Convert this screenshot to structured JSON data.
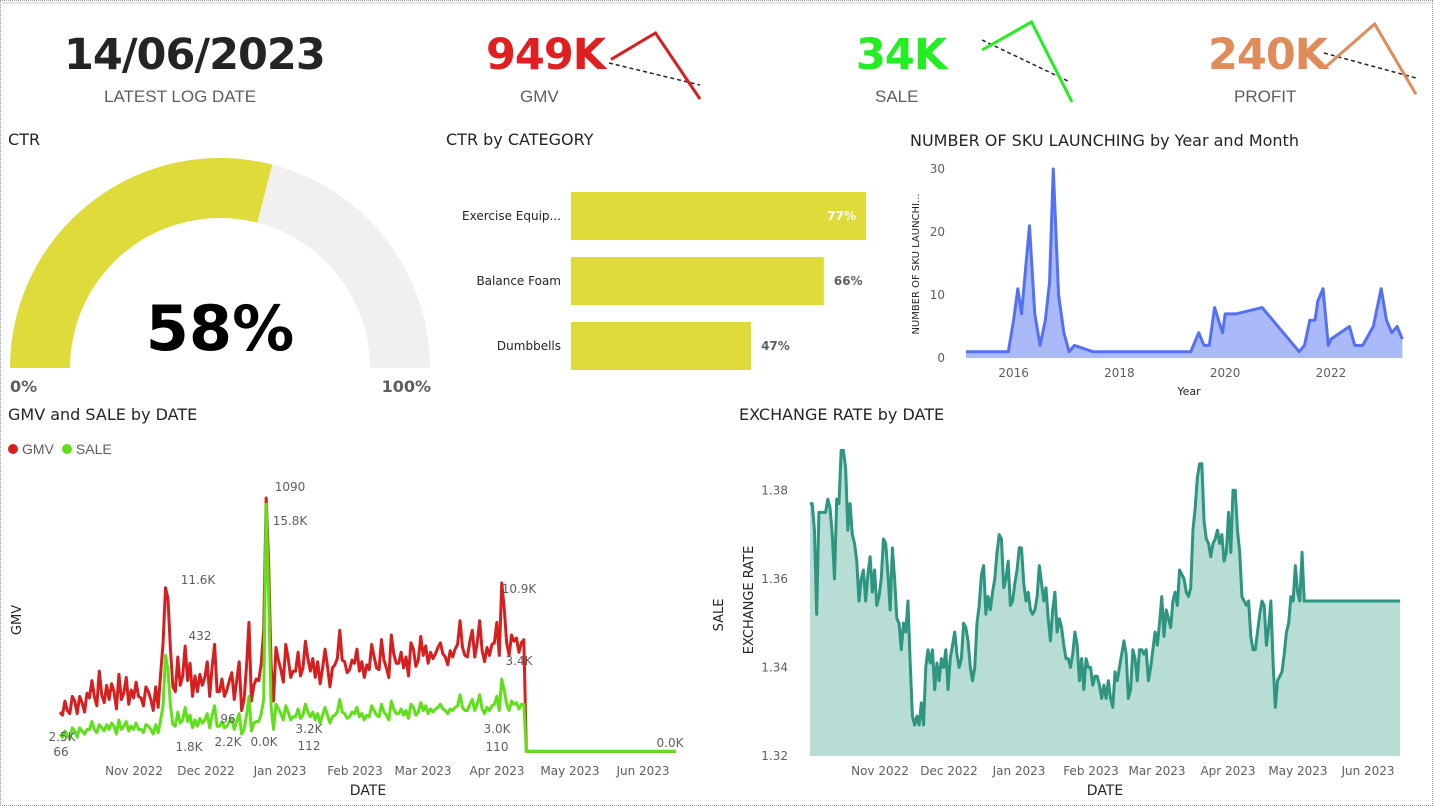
{
  "kpis": {
    "date": {
      "value": "14/06/2023",
      "label": "LATEST LOG DATE"
    },
    "gmv": {
      "value": "949K",
      "label": "GMV",
      "color": "#e02020"
    },
    "sale": {
      "value": "34K",
      "label": "SALE",
      "color": "#22ee22"
    },
    "profit": {
      "value": "240K",
      "label": "PROFIT",
      "color": "#e08c5a"
    }
  },
  "colors": {
    "gauge": "#dedb3a",
    "gauge_bg": "#f1f0ef",
    "bar": "#dedb3a",
    "sku_line": "#5470f5",
    "sku_fill": "#aabaf8",
    "gmv": "#d71f1f",
    "sale": "#5fe01a",
    "fx_line": "#2e9580",
    "fx_fill": "#b7ddd5"
  },
  "chart_data": [
    {
      "type": "gauge",
      "title": "CTR",
      "value": 58,
      "value_label": "58%",
      "min_label": "0%",
      "max_label": "100%"
    },
    {
      "type": "bar",
      "title": "CTR by CATEGORY",
      "categories": [
        "Exercise Equip...",
        "Balance Foam",
        "Dumbbells"
      ],
      "values": [
        77,
        66,
        47
      ],
      "value_labels": [
        "77%",
        "66%",
        "47%"
      ]
    },
    {
      "type": "area",
      "title": "NUMBER OF SKU LAUNCHING by Year and Month",
      "xlabel": "Year",
      "ylabel": "NUMBER OF SKU LAUNCHI...",
      "xticks": [
        "2016",
        "2018",
        "2020",
        "2022"
      ],
      "yticks": [
        "0",
        "10",
        "20",
        "30"
      ],
      "xlim": [
        2015.1,
        2023.4
      ],
      "ylim": [
        0,
        30
      ],
      "x": [
        2015.1,
        2015.4,
        2015.7,
        2015.9,
        2016.0,
        2016.08,
        2016.15,
        2016.3,
        2016.4,
        2016.5,
        2016.55,
        2016.6,
        2016.68,
        2016.75,
        2016.85,
        2016.95,
        2017.05,
        2017.15,
        2017.5,
        2018.5,
        2019.35,
        2019.5,
        2019.6,
        2019.7,
        2019.8,
        2019.95,
        2020.0,
        2020.2,
        2020.7,
        2021.4,
        2021.5,
        2021.6,
        2021.7,
        2021.75,
        2021.85,
        2021.95,
        2022.0,
        2022.35,
        2022.45,
        2022.6,
        2022.8,
        2022.95,
        2023.05,
        2023.15,
        2023.25,
        2023.35
      ],
      "values": [
        1,
        1,
        1,
        1,
        6,
        11,
        7,
        21,
        7,
        2,
        4,
        6,
        12,
        30,
        10,
        4,
        1,
        2,
        1,
        1,
        1,
        4,
        2,
        2,
        8,
        4,
        7,
        7,
        8,
        1,
        2,
        6,
        6,
        9,
        11,
        2,
        3,
        5,
        2,
        2,
        5,
        11,
        6,
        4,
        5,
        3
      ]
    },
    {
      "type": "line",
      "title": "GMV and SALE by DATE",
      "xlabel": "DATE",
      "ylabel": "GMV",
      "xticks": [
        "Nov 2022",
        "Dec 2022",
        "Jan 2023",
        "Feb 2023",
        "Mar 2023",
        "Apr 2023",
        "May 2023",
        "Jun 2023"
      ],
      "series": [
        {
          "name": "GMV",
          "data_labels": [
            "2.5K",
            "11.6K",
            "1.8K",
            "2.2K",
            "0.0K",
            "1090",
            "3.2K",
            "10.9K",
            "3.0K",
            "0.0K"
          ],
          "values": [
            2.6,
            2.4,
            3.3,
            2.7,
            2.5,
            3.6,
            3.3,
            2.5,
            3.6,
            3.2,
            2.6,
            3.8,
            3.5,
            4.6,
            3.6,
            3.0,
            5.2,
            3.7,
            3.2,
            4.3,
            3.4,
            4.4,
            3.9,
            2.8,
            5.0,
            3.4,
            3.8,
            4.8,
            3.1,
            4.0,
            3.5,
            4.5,
            3.6,
            3.5,
            3.0,
            4.2,
            3.9,
            3.4,
            2.7,
            4.2,
            2.9,
            5.0,
            7.0,
            10.5,
            9.8,
            6.6,
            4.2,
            3.9,
            6.1,
            4.3,
            4.9,
            6.8,
            4.6,
            5.7,
            3.6,
            4.9,
            3.9,
            5.0,
            4.3,
            4.8,
            5.8,
            3.6,
            5.5,
            6.9,
            3.9,
            3.9,
            4.7,
            3.6,
            4.0,
            4.6,
            5.1,
            3.4,
            4.6,
            5.8,
            2.7,
            3.4,
            5.5,
            8.3,
            3.3,
            4.3,
            4.7,
            4.6,
            5.7,
            7.8,
            16.2,
            12.2,
            5.6,
            3.3,
            6.7,
            5.9,
            5.3,
            4.5,
            6.9,
            6.0,
            4.8,
            5.2,
            5.2,
            6.4,
            4.9,
            5.4,
            7.1,
            6.0,
            5.2,
            6.0,
            4.8,
            5.8,
            4.4,
            5.4,
            6.6,
            5.5,
            4.2,
            5.4,
            5.6,
            6.0,
            7.8,
            5.9,
            5.8,
            5.1,
            5.3,
            5.9,
            5.7,
            6.6,
            5.2,
            5.8,
            4.8,
            5.6,
            5.3,
            6.9,
            6.1,
            5.4,
            5.3,
            7.2,
            5.9,
            5.4,
            4.8,
            7.5,
            6.3,
            5.7,
            5.7,
            6.4,
            5.4,
            6.1,
            4.9,
            7.0,
            6.6,
            5.5,
            5.9,
            7.4,
            6.2,
            6.8,
            5.7,
            6.4,
            6.0,
            6.3,
            6.7,
            7.0,
            6.3,
            6.1,
            5.6,
            6.5,
            6.1,
            6.6,
            6.9,
            8.4,
            6.7,
            6.2,
            6.1,
            7.1,
            7.8,
            6.1,
            7.0,
            8.4,
            6.5,
            5.8,
            6.7,
            6.2,
            6.9,
            7.0,
            8.3,
            6.2,
            10.8,
            9.2,
            7.0,
            6.2,
            7.5,
            7.1,
            7.3,
            6.4,
            7.0,
            7.2,
            0.2,
            0.1,
            0.1,
            0.1,
            0.1,
            0.1,
            0.1,
            0.1,
            0.1,
            0.1,
            0.1,
            0.1,
            0.1,
            0.1,
            0.1,
            0.1,
            0.1,
            0.1,
            0.1,
            0.1,
            0.1,
            0.1,
            0.1,
            0.1,
            0.1,
            0.1,
            0.1,
            0.1,
            0.1,
            0.1,
            0.1,
            0.1,
            0.1,
            0.1,
            0.1,
            0.1,
            0.1,
            0.1,
            0.1,
            0.1,
            0.1,
            0.1,
            0.1,
            0.1,
            0.1,
            0.1,
            0.1,
            0.1,
            0.1,
            0.1,
            0.1,
            0.1,
            0.1,
            0.1,
            0.1,
            0.1,
            0.1,
            0.1,
            0.1,
            0.1,
            0.1,
            0.1
          ]
        },
        {
          "name": "SALE",
          "data_labels": [
            "66",
            "432",
            "96",
            "15.8K",
            "112",
            "110",
            "3.4K"
          ],
          "values": [
            1.2,
            1.0,
            1.4,
            1.1,
            0.9,
            1.6,
            1.4,
            1.0,
            1.6,
            1.4,
            1.2,
            1.5,
            1.5,
            2.0,
            1.5,
            1.3,
            1.8,
            1.6,
            1.4,
            1.8,
            1.5,
            1.9,
            1.7,
            1.2,
            2.1,
            1.5,
            1.7,
            2.0,
            1.4,
            1.7,
            1.5,
            1.9,
            1.5,
            1.5,
            1.3,
            1.8,
            1.7,
            1.5,
            1.2,
            1.8,
            1.3,
            2.1,
            3.0,
            6.2,
            5.3,
            3.0,
            1.8,
            1.7,
            2.6,
            1.9,
            2.1,
            2.9,
            2.0,
            2.4,
            1.6,
            2.1,
            1.7,
            2.2,
            1.9,
            2.1,
            2.5,
            1.6,
            2.4,
            3.0,
            1.7,
            1.7,
            2.0,
            1.6,
            1.7,
            2.0,
            2.2,
            1.5,
            2.0,
            2.5,
            1.2,
            1.5,
            2.4,
            3.6,
            1.4,
            1.9,
            2.0,
            2.0,
            2.5,
            3.4,
            15.8,
            10.2,
            3.0,
            1.5,
            3.1,
            2.8,
            2.5,
            2.1,
            3.0,
            2.6,
            2.1,
            2.3,
            2.3,
            2.8,
            2.2,
            2.4,
            3.1,
            2.6,
            2.3,
            2.6,
            2.1,
            2.5,
            1.9,
            2.4,
            2.9,
            2.4,
            1.9,
            2.3,
            2.4,
            2.6,
            3.4,
            2.6,
            2.5,
            2.2,
            2.3,
            2.6,
            2.5,
            2.9,
            2.3,
            2.5,
            2.1,
            2.4,
            2.3,
            3.0,
            2.7,
            2.4,
            2.3,
            3.1,
            2.6,
            2.4,
            2.1,
            3.3,
            2.8,
            2.5,
            2.5,
            2.8,
            2.4,
            2.7,
            2.2,
            3.1,
            2.9,
            2.4,
            2.6,
            3.2,
            2.7,
            3.0,
            2.5,
            2.8,
            2.6,
            2.8,
            2.9,
            3.1,
            2.8,
            2.7,
            2.5,
            2.8,
            2.7,
            2.9,
            3.0,
            3.7,
            2.9,
            2.7,
            2.7,
            3.1,
            3.4,
            2.7,
            3.1,
            3.7,
            2.8,
            2.5,
            2.9,
            2.7,
            3.0,
            3.1,
            3.6,
            2.7,
            4.7,
            4.0,
            3.1,
            2.7,
            3.3,
            3.1,
            3.2,
            2.8,
            3.1,
            3.1,
            0.1,
            0.1,
            0.1,
            0.1,
            0.1,
            0.1,
            0.1,
            0.1,
            0.1,
            0.1,
            0.1,
            0.1,
            0.1,
            0.1,
            0.1,
            0.1,
            0.1,
            0.1,
            0.1,
            0.1,
            0.1,
            0.1,
            0.1,
            0.1,
            0.1,
            0.1,
            0.1,
            0.1,
            0.1,
            0.1,
            0.1,
            0.1,
            0.1,
            0.1,
            0.1,
            0.1,
            0.1,
            0.1,
            0.1,
            0.1,
            0.1,
            0.1,
            0.1,
            0.1,
            0.1,
            0.1,
            0.1,
            0.1,
            0.1,
            0.1,
            0.1,
            0.1,
            0.1,
            0.1,
            0.1,
            0.1,
            0.1,
            0.1,
            0.1,
            0.1,
            0.1,
            0.1
          ]
        }
      ]
    },
    {
      "type": "area",
      "title": "EXCHANGE RATE by DATE",
      "xlabel": "DATE",
      "ylabel": "EXCHANGE RATE",
      "ylabel2": "SALE",
      "xticks": [
        "Nov 2022",
        "Dec 2022",
        "Jan 2023",
        "Feb 2023",
        "Mar 2023",
        "Apr 2023",
        "May 2023",
        "Jun 2023"
      ],
      "yticks": [
        "1.32",
        "1.34",
        "1.36",
        "1.38"
      ],
      "ylim": [
        1.32,
        1.39
      ],
      "values": [
        1.377,
        1.377,
        1.371,
        1.352,
        1.375,
        1.375,
        1.375,
        1.375,
        1.378,
        1.376,
        1.37,
        1.36,
        1.378,
        1.377,
        1.389,
        1.389,
        1.385,
        1.371,
        1.377,
        1.37,
        1.368,
        1.364,
        1.355,
        1.36,
        1.362,
        1.355,
        1.361,
        1.365,
        1.357,
        1.362,
        1.354,
        1.356,
        1.36,
        1.369,
        1.368,
        1.361,
        1.353,
        1.367,
        1.36,
        1.351,
        1.35,
        1.344,
        1.35,
        1.348,
        1.355,
        1.341,
        1.329,
        1.327,
        1.329,
        1.327,
        1.332,
        1.327,
        1.34,
        1.344,
        1.341,
        1.344,
        1.335,
        1.341,
        1.337,
        1.342,
        1.34,
        1.344,
        1.335,
        1.342,
        1.345,
        1.348,
        1.343,
        1.34,
        1.342,
        1.35,
        1.349,
        1.346,
        1.34,
        1.337,
        1.34,
        1.35,
        1.354,
        1.361,
        1.363,
        1.352,
        1.356,
        1.353,
        1.357,
        1.36,
        1.366,
        1.37,
        1.369,
        1.358,
        1.36,
        1.364,
        1.354,
        1.355,
        1.359,
        1.362,
        1.367,
        1.367,
        1.359,
        1.355,
        1.357,
        1.353,
        1.352,
        1.353,
        1.356,
        1.363,
        1.359,
        1.355,
        1.358,
        1.351,
        1.346,
        1.353,
        1.357,
        1.348,
        1.351,
        1.349,
        1.345,
        1.342,
        1.342,
        1.34,
        1.343,
        1.348,
        1.345,
        1.337,
        1.342,
        1.335,
        1.342,
        1.34,
        1.34,
        1.336,
        1.338,
        1.338,
        1.336,
        1.333,
        1.336,
        1.333,
        1.337,
        1.333,
        1.331,
        1.339,
        1.337,
        1.34,
        1.343,
        1.346,
        1.343,
        1.333,
        1.335,
        1.344,
        1.342,
        1.337,
        1.344,
        1.344,
        1.343,
        1.344,
        1.337,
        1.34,
        1.344,
        1.348,
        1.345,
        1.35,
        1.356,
        1.347,
        1.353,
        1.351,
        1.349,
        1.355,
        1.357,
        1.354,
        1.362,
        1.361,
        1.36,
        1.357,
        1.356,
        1.358,
        1.371,
        1.376,
        1.383,
        1.386,
        1.386,
        1.373,
        1.369,
        1.368,
        1.365,
        1.368,
        1.369,
        1.371,
        1.368,
        1.37,
        1.364,
        1.366,
        1.375,
        1.366,
        1.38,
        1.38,
        1.371,
        1.366,
        1.356,
        1.355,
        1.354,
        1.355,
        1.347,
        1.344,
        1.344,
        1.348,
        1.352,
        1.355,
        1.354,
        1.345,
        1.349,
        1.355,
        1.341,
        1.331,
        1.337,
        1.338,
        1.339,
        1.343,
        1.348,
        1.35,
        1.356,
        1.355,
        1.363,
        1.357,
        1.355,
        1.366,
        1.355,
        1.355,
        1.355,
        1.355,
        1.355,
        1.355,
        1.355,
        1.355,
        1.355,
        1.355,
        1.355,
        1.355,
        1.355,
        1.355,
        1.355,
        1.355,
        1.355,
        1.355,
        1.355,
        1.355,
        1.355,
        1.355,
        1.355,
        1.355,
        1.355,
        1.355,
        1.355,
        1.355,
        1.355,
        1.355,
        1.355,
        1.355,
        1.355,
        1.355,
        1.355,
        1.355,
        1.355,
        1.355,
        1.355,
        1.355,
        1.355,
        1.355,
        1.355,
        1.355
      ]
    }
  ],
  "sparklines": {
    "gmv": [
      0.4,
      0.0,
      1.0
    ],
    "sale": [
      0.35,
      0.0,
      1.0
    ],
    "profit": [
      0.6,
      0.0,
      0.95
    ]
  }
}
